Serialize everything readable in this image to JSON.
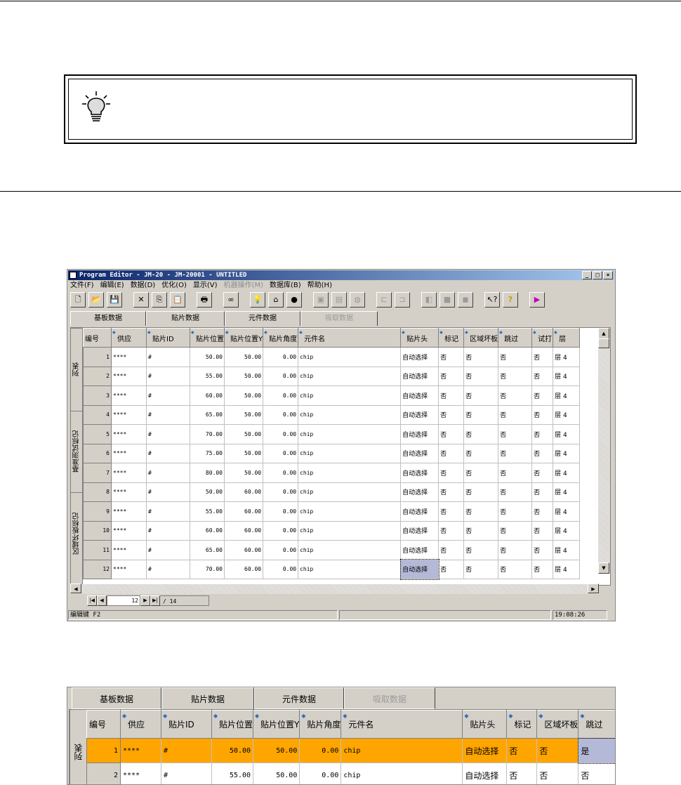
{
  "window": {
    "title": "Program Editor - JM-20 - JM-20001 - UNTITLED",
    "controls": [
      "_",
      "□",
      "×"
    ]
  },
  "menu": {
    "file": "文件(F)",
    "edit": "编辑(E)",
    "data": "数据(D)",
    "optimize": "优化(O)",
    "view": "显示(V)",
    "machine": "机器操作(M)",
    "database": "数据库(B)",
    "help": "帮助(H)"
  },
  "toolbar": {
    "icons": [
      "new-icon",
      "open-icon",
      "save-icon",
      "delete-icon",
      "copy-icon",
      "paste-icon",
      "print-icon",
      "find-icon",
      "bulb-icon",
      "tree-icon",
      "color-icon",
      "disabled-1-icon",
      "disabled-2-icon",
      "disabled-3-icon",
      "align-left-icon",
      "align-right-icon",
      "disabled-4-icon",
      "disabled-5-icon",
      "disabled-6-icon",
      "context-help-icon",
      "help-icon",
      "exit-icon"
    ]
  },
  "tabs": [
    "基板数据",
    "贴片数据",
    "元件数据",
    "吸取数据"
  ],
  "side_tabs": [
    "列表",
    "基准测试标记",
    "区域坏板标记"
  ],
  "grid": {
    "headers": [
      "编号",
      "供应",
      "贴片ID",
      "贴片位置",
      "贴片位置Y",
      "贴片角度",
      "元件名",
      "贴片头",
      "标记",
      "区域坏板",
      "跳过",
      "试打",
      "层"
    ],
    "rows": [
      [
        "1",
        "****",
        "#",
        "50.00",
        "50.00",
        "0.00",
        "chip",
        "自动选择",
        "否",
        "否",
        "否",
        "否",
        "层 4"
      ],
      [
        "2",
        "****",
        "#",
        "55.00",
        "50.00",
        "0.00",
        "chip",
        "自动选择",
        "否",
        "否",
        "否",
        "否",
        "层 4"
      ],
      [
        "3",
        "****",
        "#",
        "60.00",
        "50.00",
        "0.00",
        "chip",
        "自动选择",
        "否",
        "否",
        "否",
        "否",
        "层 4"
      ],
      [
        "4",
        "****",
        "#",
        "65.00",
        "50.00",
        "0.00",
        "chip",
        "自动选择",
        "否",
        "否",
        "否",
        "否",
        "层 4"
      ],
      [
        "5",
        "****",
        "#",
        "70.00",
        "50.00",
        "0.00",
        "chip",
        "自动选择",
        "否",
        "否",
        "否",
        "否",
        "层 4"
      ],
      [
        "6",
        "****",
        "#",
        "75.00",
        "50.00",
        "0.00",
        "chip",
        "自动选择",
        "否",
        "否",
        "否",
        "否",
        "层 4"
      ],
      [
        "7",
        "****",
        "#",
        "80.00",
        "50.00",
        "0.00",
        "chip",
        "自动选择",
        "否",
        "否",
        "否",
        "否",
        "层 4"
      ],
      [
        "8",
        "****",
        "#",
        "50.00",
        "60.00",
        "0.00",
        "chip",
        "自动选择",
        "否",
        "否",
        "否",
        "否",
        "层 4"
      ],
      [
        "9",
        "****",
        "#",
        "55.00",
        "60.00",
        "0.00",
        "chip",
        "自动选择",
        "否",
        "否",
        "否",
        "否",
        "层 4"
      ],
      [
        "10",
        "****",
        "#",
        "60.00",
        "60.00",
        "0.00",
        "chip",
        "自动选择",
        "否",
        "否",
        "否",
        "否",
        "层 4"
      ],
      [
        "11",
        "****",
        "#",
        "65.00",
        "60.00",
        "0.00",
        "chip",
        "自动选择",
        "否",
        "否",
        "否",
        "否",
        "层 4"
      ],
      [
        "12",
        "****",
        "#",
        "70.00",
        "60.00",
        "0.00",
        "chip",
        "自动选择",
        "否",
        "否",
        "否",
        "否",
        "层 4"
      ]
    ]
  },
  "navigator": {
    "current": "12",
    "total": "/ 14"
  },
  "status": {
    "left": "编辑键 F2",
    "time": "19:08:26"
  },
  "zoom": {
    "tabs": [
      "基板数据",
      "贴片数据",
      "元件数据",
      "吸取数据"
    ],
    "side_tab": "列表",
    "headers": [
      "编号",
      "供应",
      "贴片ID",
      "贴片位置",
      "贴片位置Y",
      "贴片角度",
      "元件名",
      "贴片头",
      "标记",
      "区域坏板",
      "跳过"
    ],
    "rows": [
      [
        "1",
        "****",
        "#",
        "50.00",
        "50.00",
        "0.00",
        "chip",
        "自动选择",
        "否",
        "否",
        "是"
      ],
      [
        "2",
        "****",
        "#",
        "55.00",
        "50.00",
        "0.00",
        "chip",
        "自动选择",
        "否",
        "否",
        "否"
      ]
    ],
    "highlight_color": "#ffa500"
  }
}
